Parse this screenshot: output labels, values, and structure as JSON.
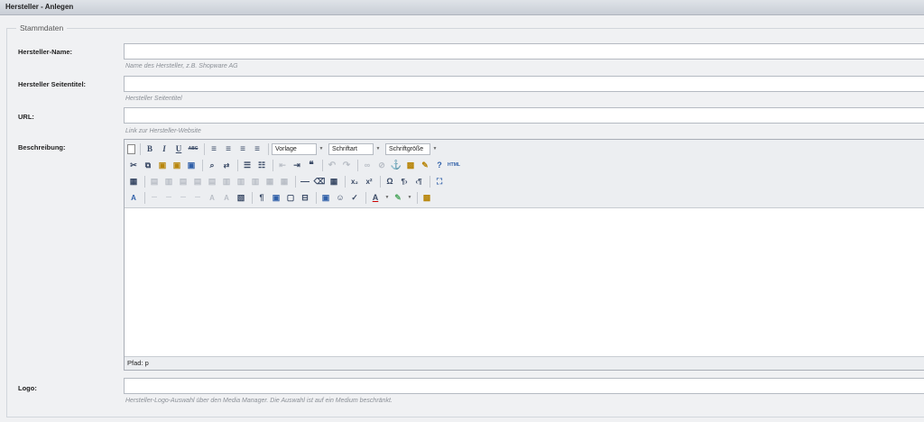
{
  "window": {
    "title": "Hersteller - Anlegen"
  },
  "fieldset": {
    "legend": "Stammdaten"
  },
  "fields": {
    "name": {
      "label": "Hersteller-Name:",
      "value": "",
      "hint": "Name des Hersteller, z.B. Shopware AG"
    },
    "seitentitel": {
      "label": "Hersteller Seitentitel:",
      "value": "",
      "hint": "Hersteller Seitentitel"
    },
    "url": {
      "label": "URL:",
      "value": "",
      "hint": "Link zur Hersteller-Website"
    },
    "beschreibung": {
      "label": "Beschreibung:"
    },
    "logo": {
      "label": "Logo:",
      "value": "",
      "hint": "Hersteller-Logo-Auswahl über den Media Manager. Die Auswahl ist auf ein Medium beschränkt."
    }
  },
  "editor": {
    "dropdowns": {
      "format": "Vorlage",
      "font": "Schriftart",
      "size": "Schriftgröße"
    },
    "status_label": "Pfad:",
    "status_path": "p",
    "buttons": {
      "row1": [
        {
          "name": "new-document-icon",
          "glyph": "▯"
        },
        {
          "name": "bold-icon",
          "glyph": "B"
        },
        {
          "name": "italic-icon",
          "glyph": "I"
        },
        {
          "name": "underline-icon",
          "glyph": "U"
        },
        {
          "name": "strikethrough-icon",
          "glyph": "ABC"
        },
        {
          "name": "align-left-icon",
          "glyph": "≡"
        },
        {
          "name": "align-center-icon",
          "glyph": "≡"
        },
        {
          "name": "align-right-icon",
          "glyph": "≡"
        },
        {
          "name": "align-justify-icon",
          "glyph": "≡"
        }
      ]
    },
    "colors": {
      "accent": "#3a4a66",
      "disabled": "#b9bec6",
      "link": "#2f5fa8"
    }
  }
}
